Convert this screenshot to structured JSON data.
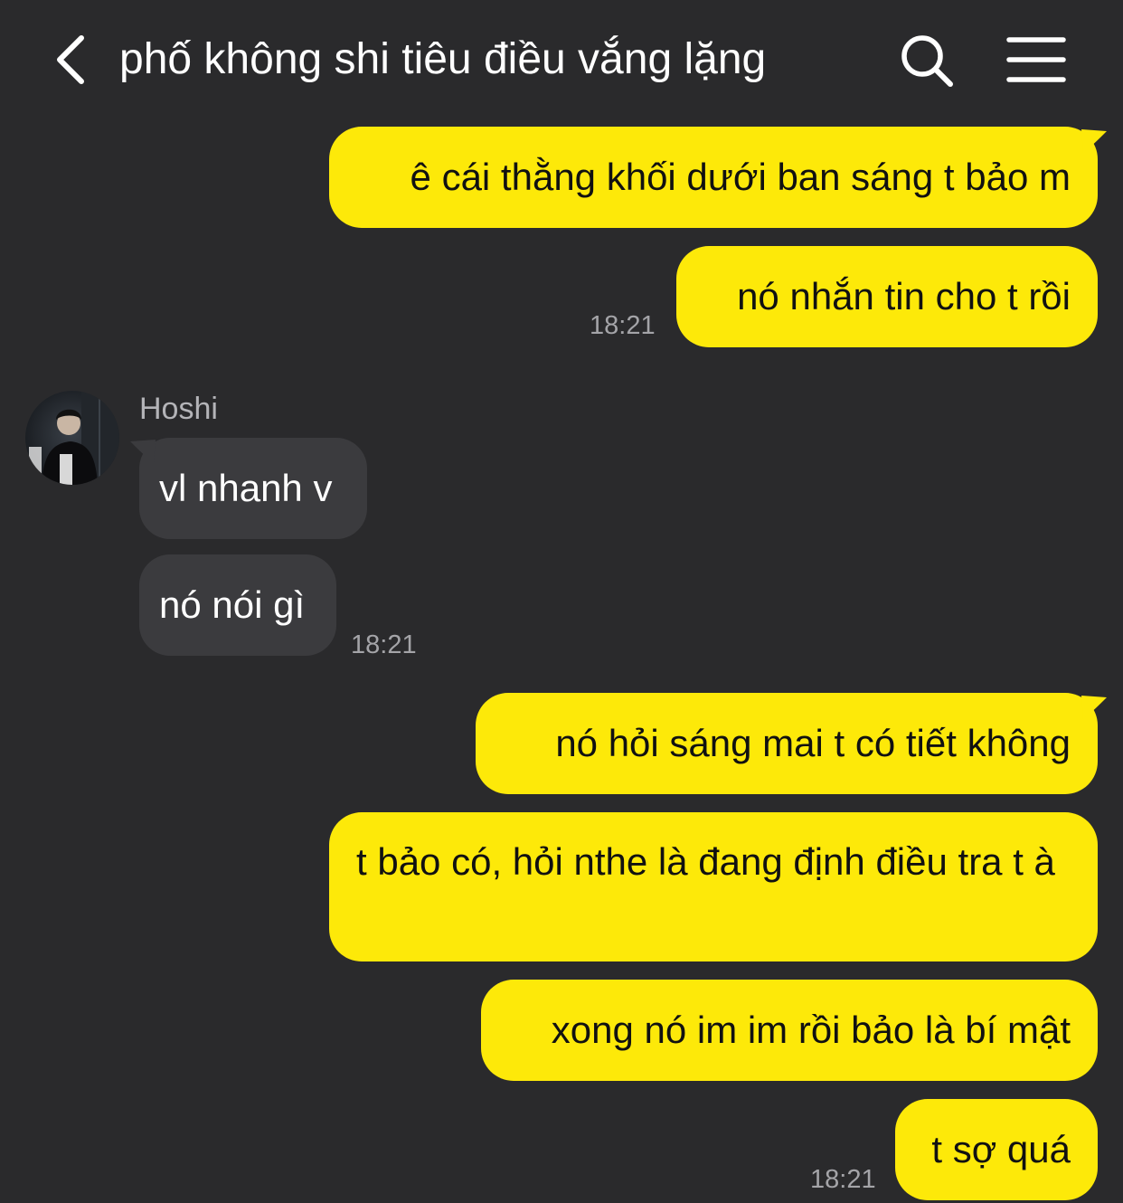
{
  "header": {
    "title": "phố không shi tiêu điều vắng lặng",
    "back_icon": "chevron-left-icon",
    "search_icon": "search-icon",
    "menu_icon": "hamburger-menu-icon"
  },
  "colors": {
    "background": "#2a2a2c",
    "sent_bubble": "#fde909",
    "received_bubble": "#3b3b3e",
    "timestamp": "#a4a4a8"
  },
  "messages": {
    "m1": {
      "text": "ê cái thằng khối dưới ban sáng t bảo m",
      "direction": "sent"
    },
    "m2": {
      "text": "nó nhắn tin cho t rồi",
      "direction": "sent",
      "time": "18:21"
    },
    "sender": {
      "name": "Hoshi",
      "avatar": "avatar-photo"
    },
    "m3": {
      "text": "vl nhanh v",
      "direction": "received"
    },
    "m4": {
      "text": "nó nói gì",
      "direction": "received",
      "time": "18:21"
    },
    "m5": {
      "text": "nó hỏi sáng mai t có tiết không",
      "direction": "sent"
    },
    "m6": {
      "text": "t bảo có, hỏi nthe là đang định điều tra t à",
      "direction": "sent"
    },
    "m7": {
      "text": "xong nó im im rồi bảo là bí mật",
      "direction": "sent"
    },
    "m8": {
      "text": "t sợ quá",
      "direction": "sent",
      "time": "18:21"
    }
  }
}
